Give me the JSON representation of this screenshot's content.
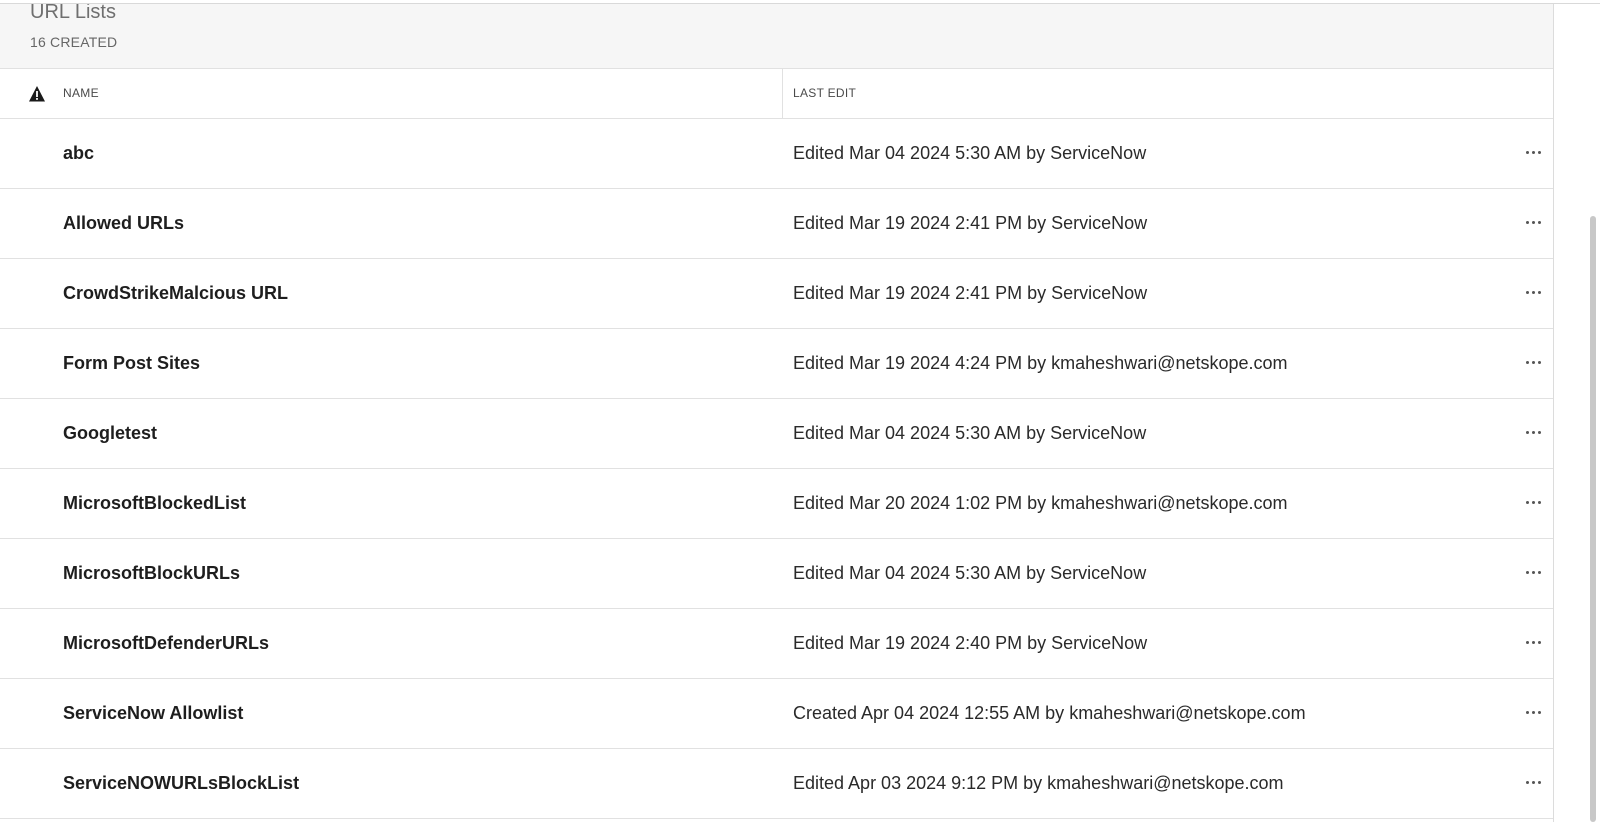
{
  "header": {
    "title": "URL Lists",
    "count_label": "16 CREATED"
  },
  "table": {
    "columns": {
      "name": "NAME",
      "last_edit": "LAST EDIT"
    },
    "rows": [
      {
        "name": "abc",
        "last_edit": "Edited Mar 04 2024 5:30 AM by ServiceNow"
      },
      {
        "name": "Allowed URLs",
        "last_edit": "Edited Mar 19 2024 2:41 PM by ServiceNow"
      },
      {
        "name": "CrowdStrikeMalcious URL",
        "last_edit": "Edited Mar 19 2024 2:41 PM by ServiceNow"
      },
      {
        "name": "Form Post Sites",
        "last_edit": "Edited Mar 19 2024 4:24 PM by kmaheshwari@netskope.com"
      },
      {
        "name": "Googletest",
        "last_edit": "Edited Mar 04 2024 5:30 AM by ServiceNow"
      },
      {
        "name": "MicrosoftBlockedList",
        "last_edit": "Edited Mar 20 2024 1:02 PM by kmaheshwari@netskope.com"
      },
      {
        "name": "MicrosoftBlockURLs",
        "last_edit": "Edited Mar 04 2024 5:30 AM by ServiceNow"
      },
      {
        "name": "MicrosoftDefenderURLs",
        "last_edit": "Edited Mar 19 2024 2:40 PM by ServiceNow"
      },
      {
        "name": "ServiceNow Allowlist",
        "last_edit": "Created Apr 04 2024 12:55 AM by kmaheshwari@netskope.com"
      },
      {
        "name": "ServiceNOWURLsBlockList",
        "last_edit": "Edited Apr 03 2024 9:12 PM by kmaheshwari@netskope.com"
      }
    ]
  },
  "icons": {
    "warning": "warning-icon",
    "row_menu": "more-horizontal-icon"
  }
}
